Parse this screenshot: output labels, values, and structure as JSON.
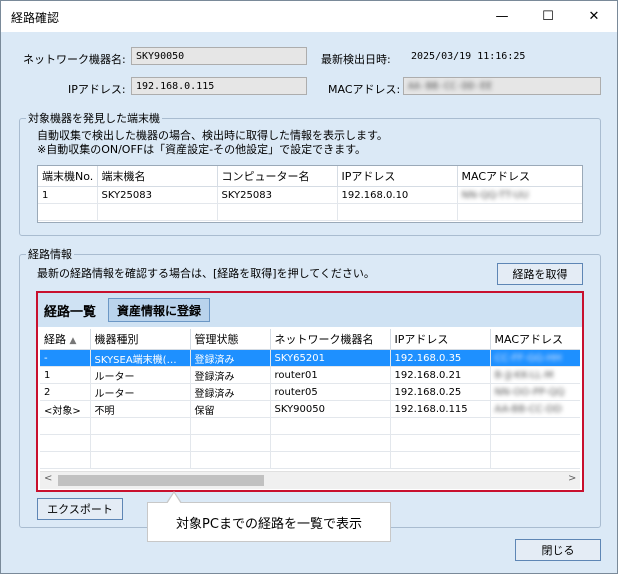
{
  "window": {
    "title": "経路確認",
    "minimize_glyph": "—",
    "maximize_glyph": "☐",
    "close_glyph": "✕"
  },
  "header": {
    "network_device_label": "ネットワーク機器名:",
    "network_device_value": "SKY90050",
    "last_detected_label": "最新検出日時:",
    "last_detected_value": "2025/03/19 11:16:25",
    "ip_label": "IPアドレス:",
    "ip_value": "192.168.0.115",
    "mac_label": "MACアドレス:",
    "mac_value": "AA-BB-CC-DD-EE"
  },
  "terminal_section": {
    "legend": "対象機器を発見した端末機",
    "note_line1": "自動収集で検出した機器の場合、検出時に取得した情報を表示します。",
    "note_line2": "※自動収集のON/OFFは「資産設定-その他設定」で設定できます。",
    "columns": [
      "端末機No.",
      "端末機名",
      "コンピューター名",
      "IPアドレス",
      "MACアドレス"
    ],
    "rows": [
      {
        "no": "1",
        "name": "SKY25083",
        "computer": "SKY25083",
        "ip": "192.168.0.10",
        "mac": "NN-QQ-TT-UU"
      }
    ]
  },
  "route_section": {
    "legend": "経路情報",
    "instruction": "最新の経路情報を確認する場合は、[経路を取得]を押してください。",
    "get_route_button": "経路を取得",
    "list_title": "経路一覧",
    "register_button": "資産情報に登録",
    "sort_glyph": "▲",
    "columns": [
      "経路",
      "機器種別",
      "管理状態",
      "ネットワーク機器名",
      "IPアドレス",
      "MACアドレス"
    ],
    "rows": [
      {
        "route": "-",
        "type": "SKYSEA端末機(…",
        "status": "登録済み",
        "device": "SKY65201",
        "ip": "192.168.0.35",
        "mac": "CC-FF-GG-HH"
      },
      {
        "route": "1",
        "type": "ルーター",
        "status": "登録済み",
        "device": "router01",
        "ip": "192.168.0.21",
        "mac": "B-JJ-KK-LL-M"
      },
      {
        "route": "2",
        "type": "ルーター",
        "status": "登録済み",
        "device": "router05",
        "ip": "192.168.0.25",
        "mac": "NN-OO-PP-QQ"
      },
      {
        "route": "<対象>",
        "type": "不明",
        "status": "保留",
        "device": "SKY90050",
        "ip": "192.168.0.115",
        "mac": "AA-BB-CC-DD"
      }
    ],
    "scroll_left_glyph": "<",
    "scroll_right_glyph": ">"
  },
  "export_button": "エクスポート",
  "callout_text": "対象PCまでの経路を一覧で表示",
  "close_button": "閉じる",
  "colors": {
    "accent_red": "#c8102e",
    "selection": "#1e90ff",
    "window_bg": "#dbe9f6"
  }
}
